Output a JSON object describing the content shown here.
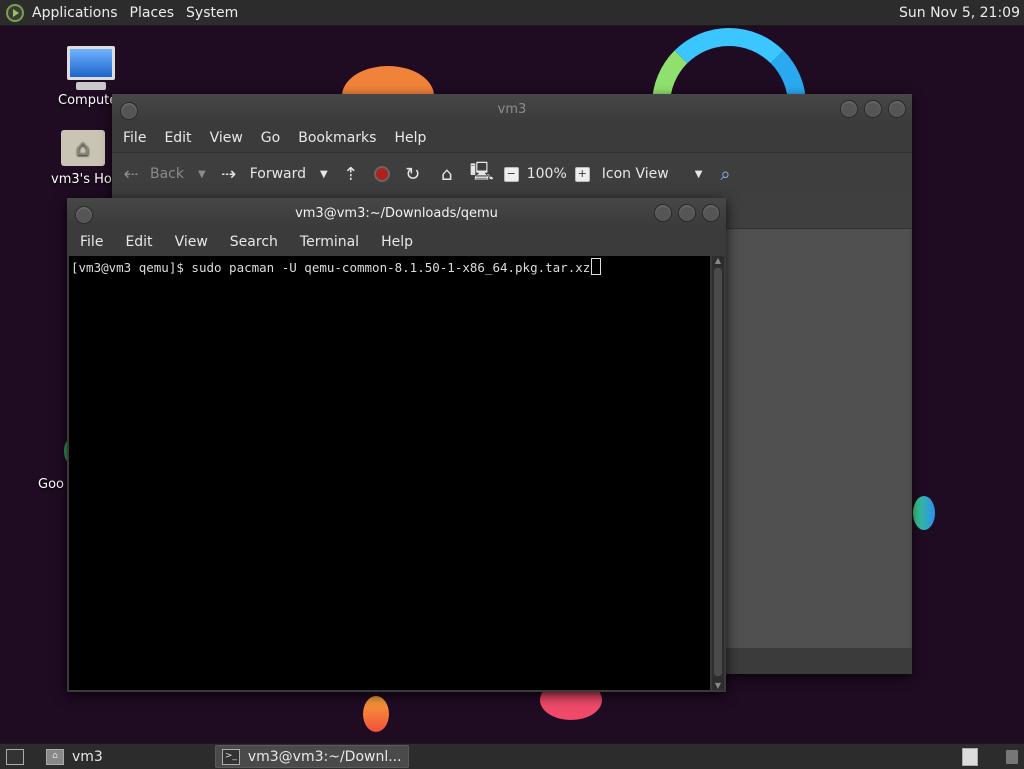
{
  "top_panel": {
    "menus": [
      "Applications",
      "Places",
      "System"
    ],
    "clock": "Sun Nov  5, 21:09"
  },
  "desktop": {
    "icons": [
      {
        "label": "Compute",
        "icon": "computer-icon"
      },
      {
        "label": "vm3's Hor",
        "icon": "home-folder-icon"
      },
      {
        "label": "Goo",
        "icon": "google-icon"
      }
    ]
  },
  "file_manager": {
    "title": "vm3",
    "menus": [
      "File",
      "Edit",
      "View",
      "Go",
      "Bookmarks",
      "Help"
    ],
    "toolbar": {
      "back": "Back",
      "forward": "Forward",
      "zoom": "100%",
      "view_mode": "Icon View"
    }
  },
  "terminal": {
    "title": "vm3@vm3:~/Downloads/qemu",
    "menus": [
      "File",
      "Edit",
      "View",
      "Search",
      "Terminal",
      "Help"
    ],
    "prompt": "[vm3@vm3 qemu]$ ",
    "command": "sudo pacman -U qemu-common-8.1.50-1-x86_64.pkg.tar.xz"
  },
  "bottom_panel": {
    "tasks": [
      {
        "label": "vm3",
        "active": false
      },
      {
        "label": "vm3@vm3:~/Downl...",
        "active": true
      }
    ]
  },
  "colors": {
    "wallpaper": "#1f0b22",
    "panel": "#2c2c2c",
    "terminal_bg": "#000000",
    "stop_red": "#b02020"
  }
}
